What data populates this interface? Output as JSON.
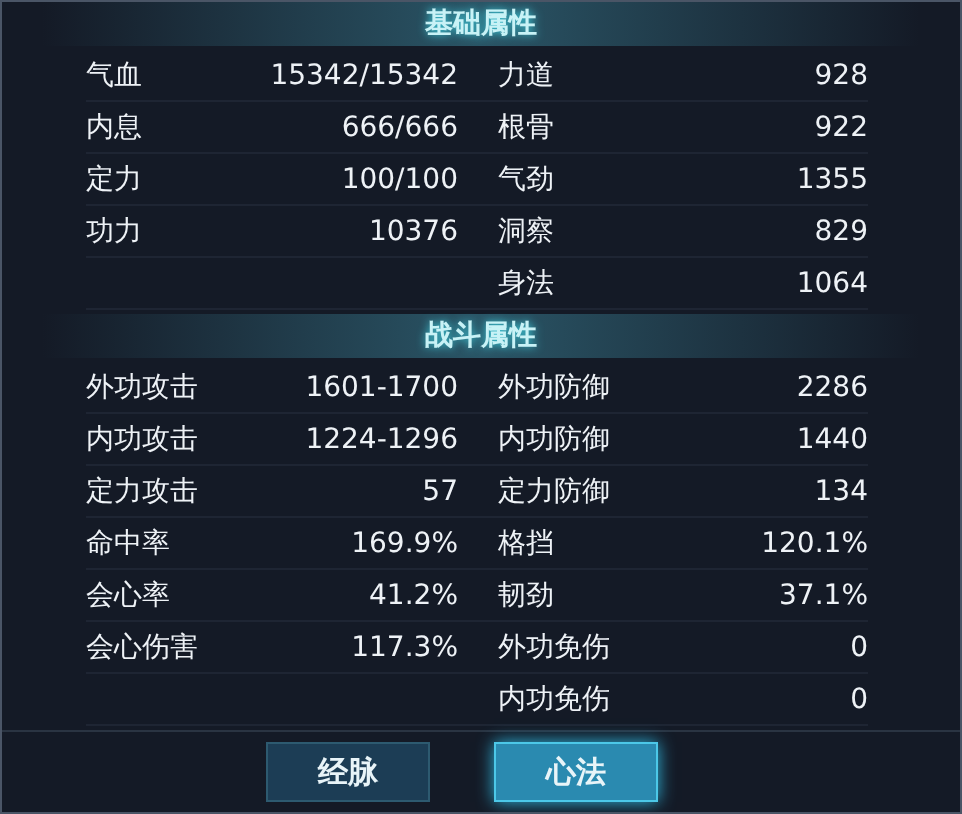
{
  "sections": [
    {
      "title": "基础属性",
      "rows": [
        {
          "left": {
            "label": "气血",
            "value": "15342/15342"
          },
          "right": {
            "label": "力道",
            "value": "928"
          }
        },
        {
          "left": {
            "label": "内息",
            "value": "666/666"
          },
          "right": {
            "label": "根骨",
            "value": "922"
          }
        },
        {
          "left": {
            "label": "定力",
            "value": "100/100"
          },
          "right": {
            "label": "气劲",
            "value": "1355"
          }
        },
        {
          "left": {
            "label": "功力",
            "value": "10376"
          },
          "right": {
            "label": "洞察",
            "value": "829"
          }
        },
        {
          "right": {
            "label": "身法",
            "value": "1064"
          }
        }
      ]
    },
    {
      "title": "战斗属性",
      "rows": [
        {
          "left": {
            "label": "外功攻击",
            "value": "1601-1700"
          },
          "right": {
            "label": "外功防御",
            "value": "2286"
          }
        },
        {
          "left": {
            "label": "内功攻击",
            "value": "1224-1296"
          },
          "right": {
            "label": "内功防御",
            "value": "1440"
          }
        },
        {
          "left": {
            "label": "定力攻击",
            "value": "57"
          },
          "right": {
            "label": "定力防御",
            "value": "134"
          }
        },
        {
          "left": {
            "label": "命中率",
            "value": "169.9%"
          },
          "right": {
            "label": "格挡",
            "value": "120.1%"
          }
        },
        {
          "left": {
            "label": "会心率",
            "value": "41.2%"
          },
          "right": {
            "label": "韧劲",
            "value": "37.1%"
          }
        },
        {
          "left": {
            "label": "会心伤害",
            "value": "117.3%"
          },
          "right": {
            "label": "外功免伤",
            "value": "0"
          }
        },
        {
          "right": {
            "label": "内功免伤",
            "value": "0"
          }
        }
      ]
    }
  ],
  "buttons": [
    {
      "label": "经脉",
      "selected": false
    },
    {
      "label": "心法",
      "selected": true
    }
  ]
}
